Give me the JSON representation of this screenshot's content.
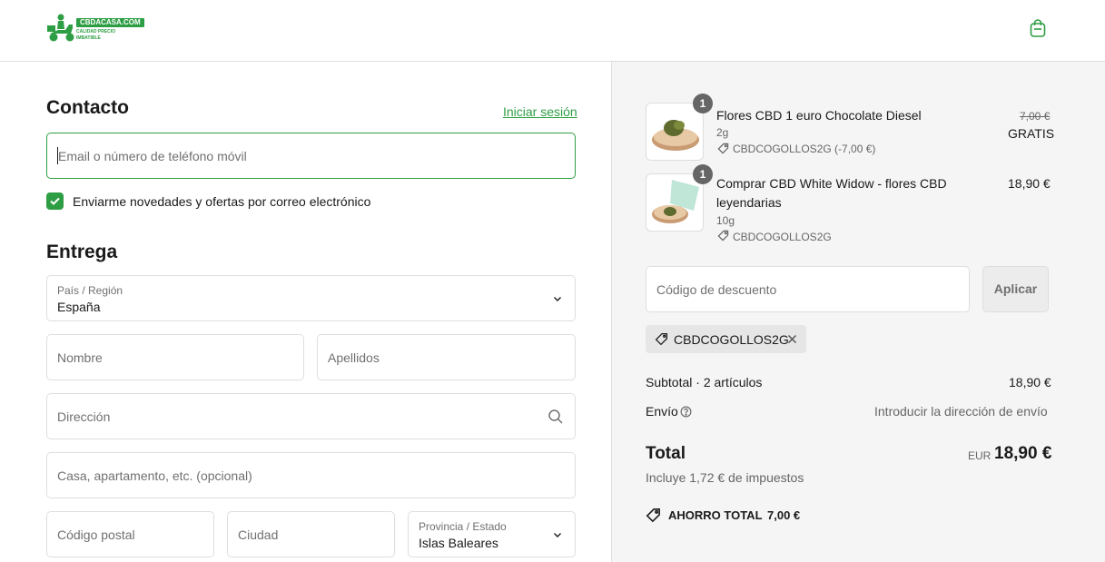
{
  "header": {
    "logo": {
      "brand": "CBDACASA.COM",
      "tagline_1": "CALIDAD PRECIO",
      "tagline_2": "IMBATIBLE"
    },
    "cart_icon": "shopping-bag-icon"
  },
  "contact": {
    "title": "Contacto",
    "login_link": "Iniciar sesión",
    "email_placeholder": "Email o número de teléfono móvil",
    "newsletter_label": "Enviarme novedades y ofertas por correo electrónico",
    "newsletter_checked": true
  },
  "delivery": {
    "title": "Entrega",
    "country_label": "País / Región",
    "country_value": "España",
    "first_name_placeholder": "Nombre",
    "last_name_placeholder": "Apellidos",
    "address_placeholder": "Dirección",
    "apartment_placeholder": "Casa, apartamento, etc. (opcional)",
    "postal_placeholder": "Código postal",
    "city_placeholder": "Ciudad",
    "province_label": "Provincia / Estado",
    "province_value": "Islas Baleares"
  },
  "summary": {
    "items": [
      {
        "quantity": "1",
        "title": "Flores CBD 1 euro Chocolate Diesel",
        "variant": "2g",
        "discount": "CBDCOGOLLOS2G (-7,00 €)",
        "original_price": "7,00 €",
        "price": "GRATIS"
      },
      {
        "quantity": "1",
        "title_line1": "Comprar CBD White Widow - flores CBD",
        "title_line2": "leyendarias",
        "variant": "10g",
        "discount": "CBDCOGOLLOS2G",
        "price": "18,90 €"
      }
    ],
    "discount_placeholder": "Código de descuento",
    "apply_label": "Aplicar",
    "applied_code": "CBDCOGOLLOS2G",
    "subtotal_label": "Subtotal · 2 artículos",
    "subtotal_value": "18,90 €",
    "shipping_label": "Envío",
    "shipping_value": "Introducir la dirección de envío",
    "total_label": "Total",
    "currency": "EUR",
    "total_value": "18,90 €",
    "taxes_note": "Incluye 1,72 € de impuestos",
    "savings_label": "AHORRO TOTAL",
    "savings_value": "7,00 €"
  },
  "colors": {
    "accent": "#2e9e44",
    "sidebar_bg": "#f5f5f5"
  }
}
